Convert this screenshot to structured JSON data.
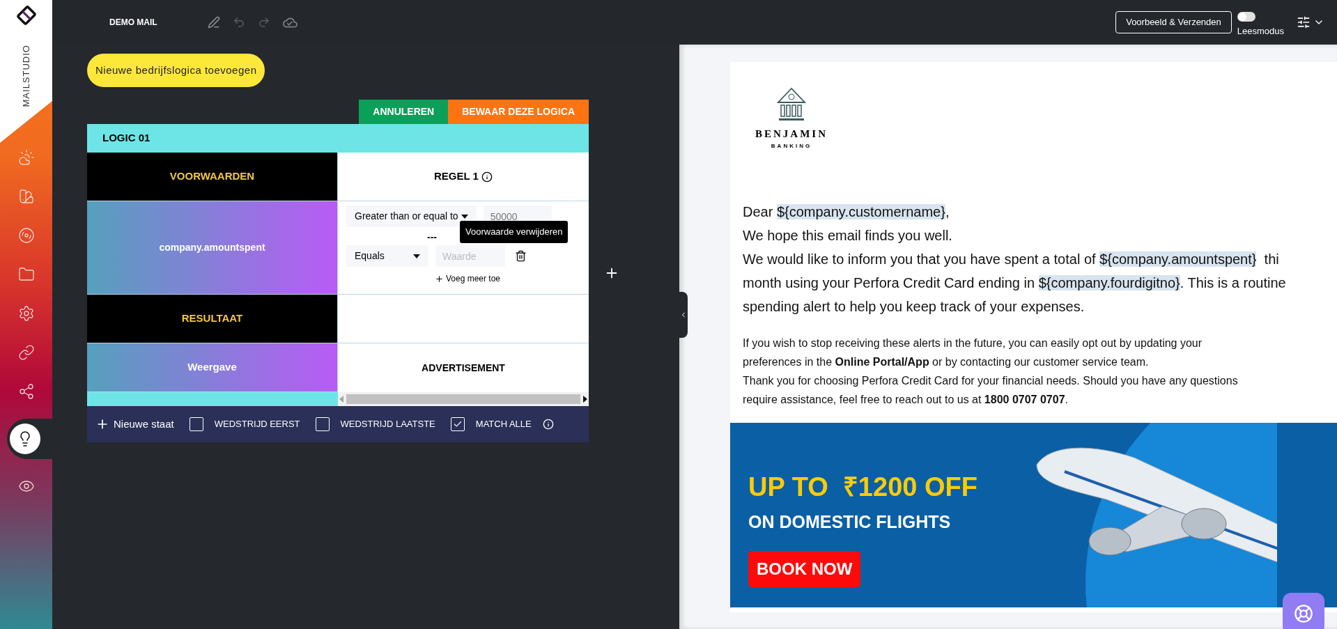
{
  "app": {
    "name": "MAILSTUDIO"
  },
  "sidebar": {
    "items": [
      {
        "selected": false
      },
      {
        "selected": false
      },
      {
        "selected": false
      },
      {
        "selected": false
      },
      {
        "selected": false
      },
      {
        "selected": false
      },
      {
        "selected": false
      },
      {
        "selected": true
      },
      {
        "selected": false
      }
    ]
  },
  "toolbar": {
    "title": "DEMO MAIL"
  },
  "header_actions": {
    "preview_button": "Voorbeeld & Verzenden",
    "read_mode": {
      "label": "Leesmodus",
      "on": false
    }
  },
  "add_logic_button": "Nieuwe bedrijfslogica toevoegen",
  "logic": {
    "cancel_button": "ANNULEREN",
    "save_button": "BEWAAR DEZE LOGICA",
    "title": "LOGIC 01",
    "conditions_label": "VOORWAARDEN",
    "rule_title": "REGEL 1",
    "field": "company.amountspent",
    "conditions": [
      {
        "operator": "Greater than or equal to",
        "value": "50000"
      },
      {
        "operator": "Equals",
        "placeholder": "Waarde"
      }
    ],
    "separator": "---",
    "tooltip": "Voorwaarde verwijderen",
    "add_more": "Voeg meer toe",
    "result_label": "RESULTAAT",
    "output_label": "Weergave",
    "output_value": "ADVERTISEMENT"
  },
  "footer": {
    "new_state": "Nieuwe staat",
    "options": [
      {
        "label": "WEDSTRIJD EERST",
        "checked": false
      },
      {
        "label": "WEDSTRIJD LAATSTE",
        "checked": false
      },
      {
        "label": "MATCH ALLE",
        "checked": true
      }
    ]
  },
  "email": {
    "logo": {
      "name": "BENJAMIN",
      "tagline": "BANKING"
    },
    "intro_lines": [
      [
        {
          "text": "Dear ",
          "variable": false
        },
        {
          "text": "${company.customername}",
          "variable": true
        },
        {
          "text": ",",
          "variable": false
        }
      ],
      [
        {
          "text": "We hope this email finds you well.",
          "variable": false
        }
      ],
      [
        {
          "text": "We would like to inform you that you have spent a total of ",
          "variable": false
        },
        {
          "text": "${company.amountspent}",
          "variable": true
        },
        {
          "text": "  thi",
          "variable": false
        }
      ],
      [
        {
          "text": "month using your Perfora Credit Card ending in ",
          "variable": false
        },
        {
          "text": "${company.fourdigitno}",
          "variable": true
        },
        {
          "text": ". This is a routine",
          "variable": false
        }
      ],
      [
        {
          "text": "spending alert to help you keep track of your expenses.",
          "variable": false
        }
      ]
    ],
    "note_lines": [
      "If you wish to stop receiving these alerts in the future, you can easily opt out by updating your",
      "preferences in the **Online Portal/App** or by contacting our customer service team.",
      "Thank you for choosing Perfora Credit Card for your financial needs. Should you have any questions",
      "require assistance, feel free to reach out to us at **1800 0707 0707**."
    ],
    "banner": {
      "headline": "UP TO  ₹1200 OFF",
      "subline": "ON DOMESTIC FLIGHTS",
      "cta": "BOOK NOW"
    }
  }
}
